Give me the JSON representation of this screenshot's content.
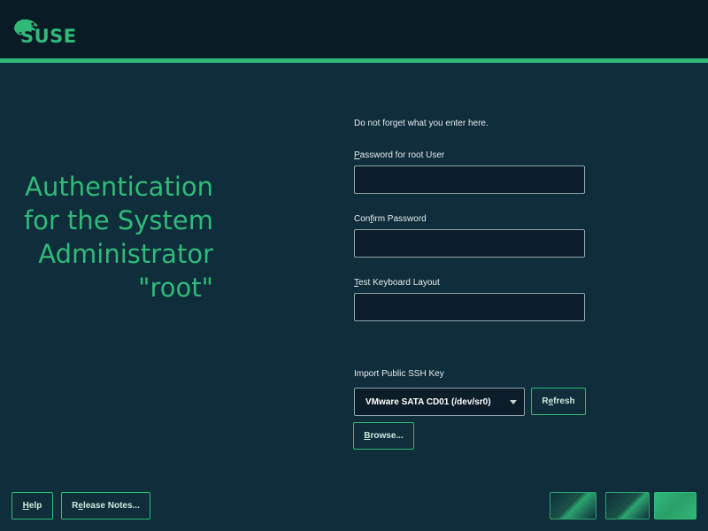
{
  "header": {
    "logo_text": "SUSE",
    "accent_color": "#30ba78"
  },
  "dialog": {
    "title_lines": [
      "Authentication",
      "for the System",
      "Administrator",
      "\"root\""
    ],
    "hint": "Do not forget what you enter here.",
    "password": {
      "label_prefix": "",
      "label_mnemonic": "P",
      "label_rest": "assword for root User",
      "value": ""
    },
    "confirm": {
      "label_prefix": "Con",
      "label_mnemonic": "f",
      "label_rest": "irm Password",
      "value": ""
    },
    "keyboard_test": {
      "label_prefix": "",
      "label_mnemonic": "T",
      "label_rest": "est Keyboard Layout",
      "value": ""
    },
    "ssh_key": {
      "label": "Import Public SSH Key",
      "selected_device": "VMware SATA CD01 (/dev/sr0)",
      "refresh_prefix": "R",
      "refresh_mnemonic": "e",
      "refresh_rest": "fresh",
      "browse_prefix": "",
      "browse_mnemonic": "B",
      "browse_rest": "rowse..."
    }
  },
  "footer": {
    "help_mnemonic": "H",
    "help_rest": "elp",
    "release_mnemonic": "e",
    "release_prefix": "R",
    "release_rest": "lease Notes..."
  }
}
